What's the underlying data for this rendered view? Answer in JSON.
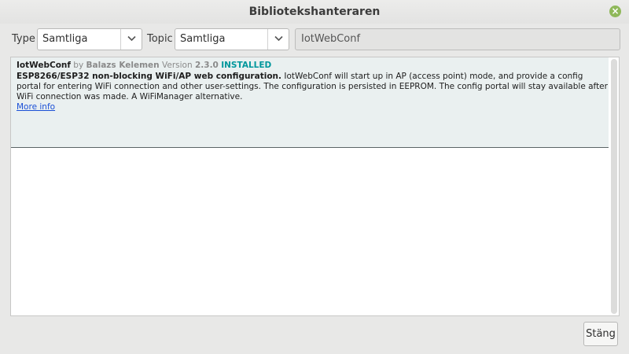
{
  "window": {
    "title": "Bibliotekshanteraren"
  },
  "filters": {
    "type_label": "Type",
    "type_value": "Samtliga",
    "topic_label": "Topic",
    "topic_value": "Samtliga",
    "search_value": "IotWebConf"
  },
  "library": {
    "name": "IotWebConf",
    "by": "by",
    "author": "Balazs Kelemen",
    "version_label": "Version",
    "version": "2.3.0",
    "status": "INSTALLED",
    "sentence": "ESP8266/ESP32 non-blocking WiFi/AP web configuration.",
    "paragraph": "IotWebConf will start up in AP (access point) mode, and provide a config portal for entering WiFi connection and other user-settings. The configuration is persisted in EEPROM. The config portal will stay available after WiFi connection was made. A WiFiManager alternative.",
    "more_info": "More info"
  },
  "footer": {
    "close_label": "Stäng"
  },
  "colors": {
    "installed": "#00979c",
    "link": "#1a4fd6",
    "close_icon": "#8fb85a"
  }
}
